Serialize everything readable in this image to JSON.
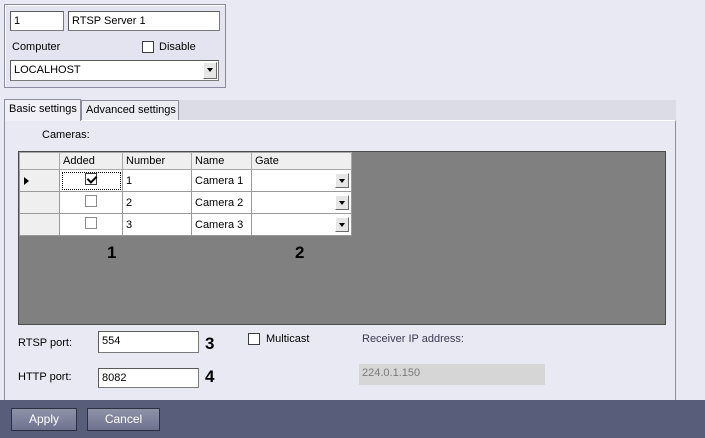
{
  "object": {
    "id": "1",
    "name": "RTSP Server 1",
    "computer_label": "Computer",
    "disable_label": "Disable",
    "disable_checked": false,
    "computer_value": "LOCALHOST"
  },
  "tabs": [
    {
      "label": "Basic settings",
      "active": true
    },
    {
      "label": "Advanced settings",
      "active": false
    }
  ],
  "cameras": {
    "label": "Cameras:",
    "columns": [
      "Added",
      "Number",
      "Name",
      "Gate"
    ],
    "rows": [
      {
        "added": true,
        "number": "1",
        "name": "Camera 1",
        "gate": ""
      },
      {
        "added": false,
        "number": "2",
        "name": "Camera 2",
        "gate": ""
      },
      {
        "added": false,
        "number": "3",
        "name": "Camera 3",
        "gate": ""
      }
    ]
  },
  "callouts": {
    "c1": "1",
    "c2": "2",
    "c3": "3",
    "c4": "4"
  },
  "rtsp": {
    "label": "RTSP port:",
    "value": "554"
  },
  "http": {
    "label": "HTTP port:",
    "value": "8082"
  },
  "multicast": {
    "label": "Multicast",
    "checked": false
  },
  "receiver": {
    "label": "Receiver IP address:",
    "value": "224.0.1.150"
  },
  "buttons": {
    "apply": "Apply",
    "cancel": "Cancel"
  },
  "colors": {
    "bottom_bar": "#585e7a",
    "grid_bg": "#808080",
    "window_bg": "#e9e9f4"
  }
}
